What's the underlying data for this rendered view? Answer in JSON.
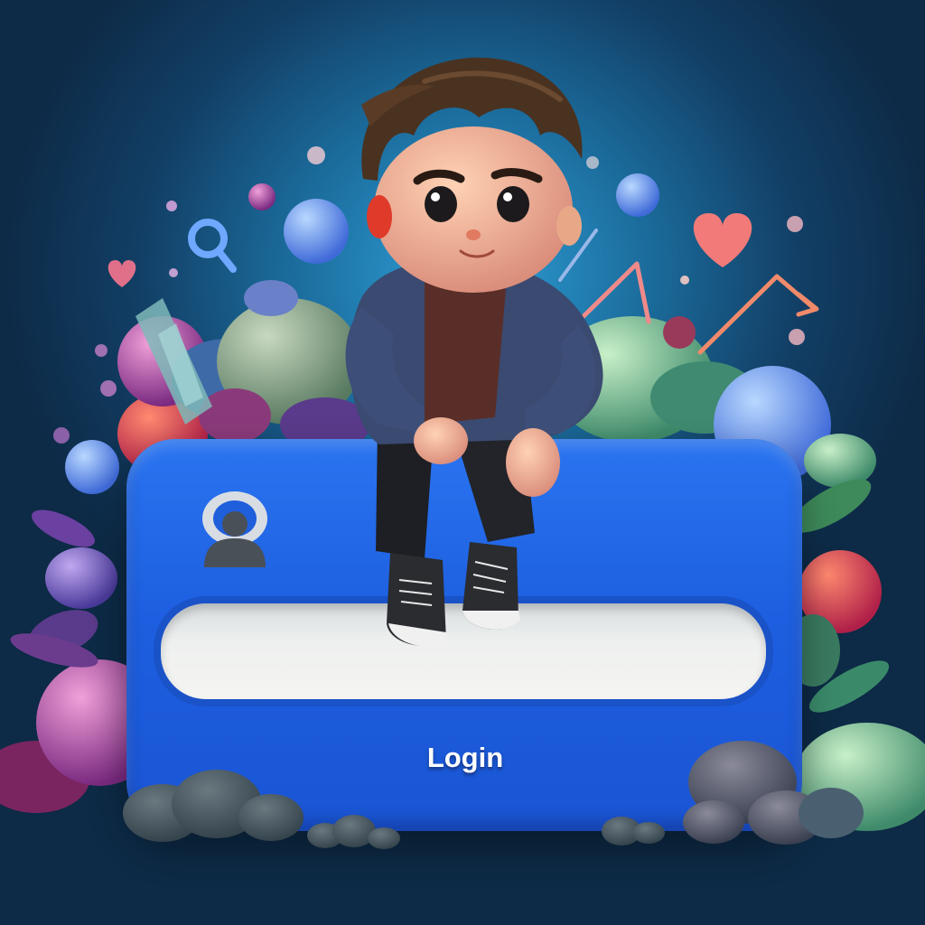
{
  "login": {
    "username_value": "",
    "button_label": "Login"
  },
  "icons": {
    "avatar": "user-avatar-icon",
    "search": "search-icon",
    "hearts": "heart-icon",
    "trend": "trend-arrow-icon"
  },
  "colors": {
    "card": "#1f60de",
    "input": "#f0f1ee",
    "background_top": "#2fa0d8",
    "background_edge": "#0d2a46",
    "heart": "#f07a78"
  }
}
